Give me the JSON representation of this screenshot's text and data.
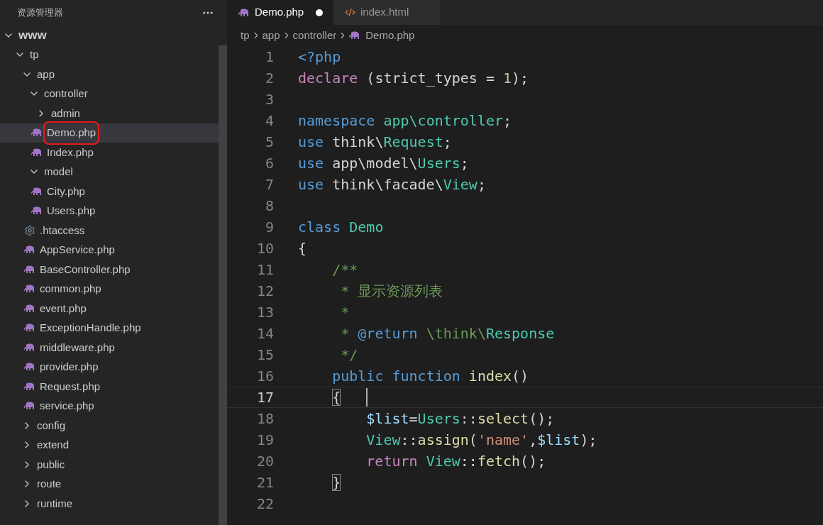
{
  "sidebar": {
    "title": "资源管理器",
    "tree": [
      {
        "name": "www",
        "kind": "folder",
        "expanded": true,
        "selected": false,
        "marked": false,
        "children": [
          {
            "name": "tp",
            "kind": "folder",
            "expanded": true,
            "selected": false,
            "marked": false,
            "children": [
              {
                "name": "app",
                "kind": "folder",
                "expanded": true,
                "selected": false,
                "marked": false,
                "children": [
                  {
                    "name": "controller",
                    "kind": "folder",
                    "expanded": true,
                    "selected": false,
                    "marked": false,
                    "children": [
                      {
                        "name": "admin",
                        "kind": "folder",
                        "expanded": false,
                        "selected": false,
                        "marked": false
                      },
                      {
                        "name": "Demo.php",
                        "kind": "php",
                        "selected": true,
                        "marked": true
                      },
                      {
                        "name": "Index.php",
                        "kind": "php",
                        "selected": false,
                        "marked": false
                      }
                    ]
                  },
                  {
                    "name": "model",
                    "kind": "folder",
                    "expanded": true,
                    "selected": false,
                    "marked": false,
                    "children": [
                      {
                        "name": "City.php",
                        "kind": "php",
                        "selected": false,
                        "marked": false
                      },
                      {
                        "name": "Users.php",
                        "kind": "php",
                        "selected": false,
                        "marked": false
                      }
                    ]
                  },
                  {
                    "name": ".htaccess",
                    "kind": "config",
                    "selected": false,
                    "marked": false
                  },
                  {
                    "name": "AppService.php",
                    "kind": "php",
                    "selected": false,
                    "marked": false
                  },
                  {
                    "name": "BaseController.php",
                    "kind": "php",
                    "selected": false,
                    "marked": false
                  },
                  {
                    "name": "common.php",
                    "kind": "php",
                    "selected": false,
                    "marked": false
                  },
                  {
                    "name": "event.php",
                    "kind": "php",
                    "selected": false,
                    "marked": false
                  },
                  {
                    "name": "ExceptionHandle.php",
                    "kind": "php",
                    "selected": false,
                    "marked": false
                  },
                  {
                    "name": "middleware.php",
                    "kind": "php",
                    "selected": false,
                    "marked": false
                  },
                  {
                    "name": "provider.php",
                    "kind": "php",
                    "selected": false,
                    "marked": false
                  },
                  {
                    "name": "Request.php",
                    "kind": "php",
                    "selected": false,
                    "marked": false
                  },
                  {
                    "name": "service.php",
                    "kind": "php",
                    "selected": false,
                    "marked": false
                  }
                ]
              },
              {
                "name": "config",
                "kind": "folder",
                "expanded": false,
                "selected": false,
                "marked": false
              },
              {
                "name": "extend",
                "kind": "folder",
                "expanded": false,
                "selected": false,
                "marked": false
              },
              {
                "name": "public",
                "kind": "folder",
                "expanded": false,
                "selected": false,
                "marked": false
              },
              {
                "name": "route",
                "kind": "folder",
                "expanded": false,
                "selected": false,
                "marked": false
              },
              {
                "name": "runtime",
                "kind": "folder",
                "expanded": false,
                "selected": false,
                "marked": false
              }
            ]
          }
        ]
      }
    ]
  },
  "tabs": [
    {
      "label": "Demo.php",
      "kind": "php",
      "selected": true,
      "modified": true
    },
    {
      "label": "index.html",
      "kind": "html",
      "selected": false,
      "modified": false
    }
  ],
  "breadcrumb": [
    {
      "label": "tp",
      "kind": "folder"
    },
    {
      "label": "app",
      "kind": "folder"
    },
    {
      "label": "controller",
      "kind": "folder"
    },
    {
      "label": "Demo.php",
      "kind": "php"
    }
  ],
  "code": {
    "lines": [
      {
        "number": "1",
        "active": false,
        "tokens": [
          {
            "text": "<?php",
            "kind": "keyword"
          }
        ]
      },
      {
        "number": "2",
        "active": false,
        "tokens": [
          {
            "text": "declare",
            "kind": "control"
          },
          {
            "text": " (strict_types = ",
            "kind": "plain"
          },
          {
            "text": "1",
            "kind": "number"
          },
          {
            "text": ");",
            "kind": "plain"
          }
        ]
      },
      {
        "number": "3",
        "active": false
      },
      {
        "number": "4",
        "active": false,
        "tokens": [
          {
            "text": "namespace",
            "kind": "keyword"
          },
          {
            "text": " app\\controller",
            "kind": "type"
          },
          {
            "text": ";",
            "kind": "plain"
          }
        ]
      },
      {
        "number": "5",
        "active": false,
        "tokens": [
          {
            "text": "use",
            "kind": "keyword"
          },
          {
            "text": " think\\",
            "kind": "plain"
          },
          {
            "text": "Request",
            "kind": "type"
          },
          {
            "text": ";",
            "kind": "plain"
          }
        ]
      },
      {
        "number": "6",
        "active": false,
        "tokens": [
          {
            "text": "use",
            "kind": "keyword"
          },
          {
            "text": " app\\model\\",
            "kind": "plain"
          },
          {
            "text": "Users",
            "kind": "type"
          },
          {
            "text": ";",
            "kind": "plain"
          }
        ]
      },
      {
        "number": "7",
        "active": false,
        "tokens": [
          {
            "text": "use",
            "kind": "keyword"
          },
          {
            "text": " think\\facade\\",
            "kind": "plain"
          },
          {
            "text": "View",
            "kind": "type"
          },
          {
            "text": ";",
            "kind": "plain"
          }
        ]
      },
      {
        "number": "8",
        "active": false
      },
      {
        "number": "9",
        "active": false,
        "tokens": [
          {
            "text": "class",
            "kind": "keyword"
          },
          {
            "text": " Demo",
            "kind": "type"
          }
        ]
      },
      {
        "number": "10",
        "active": false,
        "tokens": [
          {
            "text": "{",
            "kind": "plain"
          }
        ]
      },
      {
        "number": "11",
        "active": false,
        "tokens": [
          {
            "text": "    /**",
            "kind": "comment"
          }
        ]
      },
      {
        "number": "12",
        "active": false,
        "tokens": [
          {
            "text": "     * 显示资源列表",
            "kind": "comment"
          }
        ]
      },
      {
        "number": "13",
        "active": false,
        "tokens": [
          {
            "text": "     *",
            "kind": "comment"
          }
        ]
      },
      {
        "number": "14",
        "active": false,
        "tokens": [
          {
            "text": "     * ",
            "kind": "comment"
          },
          {
            "text": "@return",
            "kind": "keyword"
          },
          {
            "text": " \\think\\",
            "kind": "comment"
          },
          {
            "text": "Response",
            "kind": "type"
          }
        ]
      },
      {
        "number": "15",
        "active": false,
        "tokens": [
          {
            "text": "     */",
            "kind": "comment"
          }
        ]
      },
      {
        "number": "16",
        "active": false,
        "tokens": [
          {
            "text": "    public",
            "kind": "keyword"
          },
          {
            "text": " function",
            "kind": "keyword"
          },
          {
            "text": " index",
            "kind": "function"
          },
          {
            "text": "()",
            "kind": "plain"
          }
        ]
      },
      {
        "number": "17",
        "active": true,
        "tokens": [
          {
            "text": "    {",
            "kind": "bracket"
          }
        ]
      },
      {
        "number": "18",
        "active": false,
        "tokens": [
          {
            "text": "        $list",
            "kind": "variable"
          },
          {
            "text": "=",
            "kind": "plain"
          },
          {
            "text": "Users",
            "kind": "type"
          },
          {
            "text": "::",
            "kind": "plain"
          },
          {
            "text": "select",
            "kind": "function"
          },
          {
            "text": "();",
            "kind": "plain"
          }
        ]
      },
      {
        "number": "19",
        "active": false,
        "tokens": [
          {
            "text": "        View",
            "kind": "type"
          },
          {
            "text": "::",
            "kind": "plain"
          },
          {
            "text": "assign",
            "kind": "function"
          },
          {
            "text": "(",
            "kind": "plain"
          },
          {
            "text": "'name'",
            "kind": "string"
          },
          {
            "text": ",",
            "kind": "plain"
          },
          {
            "text": "$list",
            "kind": "variable"
          },
          {
            "text": ");",
            "kind": "plain"
          }
        ]
      },
      {
        "number": "20",
        "active": false,
        "tokens": [
          {
            "text": "        return",
            "kind": "control"
          },
          {
            "text": " View",
            "kind": "type"
          },
          {
            "text": "::",
            "kind": "plain"
          },
          {
            "text": "fetch",
            "kind": "function"
          },
          {
            "text": "();",
            "kind": "plain"
          }
        ]
      },
      {
        "number": "21",
        "active": false,
        "tokens": [
          {
            "text": "    }",
            "kind": "bracket"
          }
        ]
      },
      {
        "number": "22",
        "active": false
      }
    ]
  }
}
